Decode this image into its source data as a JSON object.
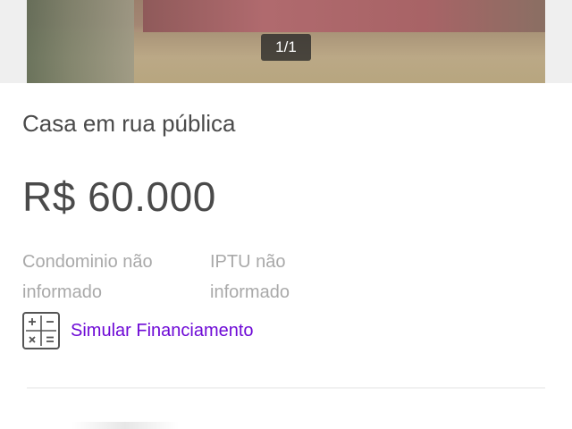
{
  "gallery": {
    "counter": "1/1"
  },
  "listing": {
    "title": "Casa em rua pública",
    "price": "R$ 60.000",
    "condominium": "Condominio não informado",
    "iptu": "IPTU não informado",
    "simulate_label": "Simular Financiamento"
  },
  "colors": {
    "accent": "#6e0ad6",
    "text_primary": "#4a4a4a",
    "text_muted": "#a9a9a9"
  },
  "icons": {
    "simulate": "calculator-icon"
  }
}
